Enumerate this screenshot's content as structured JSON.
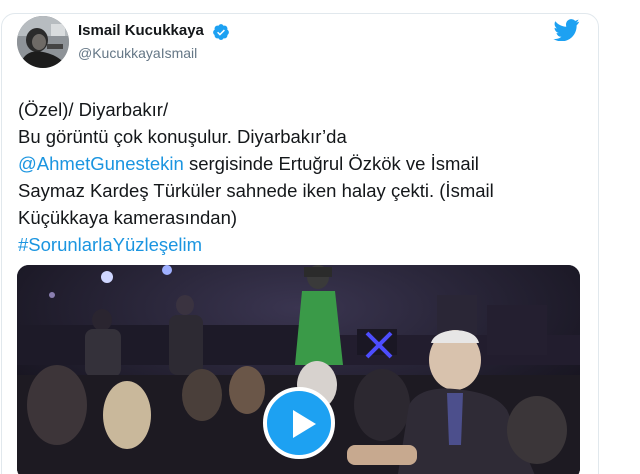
{
  "tweet": {
    "author": {
      "display_name": "Ismail Kucukkaya",
      "handle": "@KucukkayaIsmail",
      "verified": true
    },
    "lines": [
      [
        {
          "text": "(Özel)/ Diyarbakır/"
        }
      ],
      [
        {
          "text": "Bu görüntü çok konuşulur. Diyarbakır’da"
        }
      ],
      [
        {
          "text": "@AhmetGunestekin",
          "link": true
        },
        {
          "text": " sergisinde Ertuğrul Özkök ve İsmail"
        }
      ],
      [
        {
          "text": "Saymaz Kardeş Türküler sahnede iken halay çekti. (İsmail"
        }
      ],
      [
        {
          "text": "Küçükkaya kamerasından)"
        }
      ],
      [
        {
          "text": "#SorunlarlaYüzleşelim",
          "link": true
        }
      ]
    ],
    "media": {
      "type": "video",
      "play_icon": "play-icon"
    },
    "icons": {
      "brand": "twitter-bird-icon",
      "verified": "verified-badge-icon"
    },
    "colors": {
      "link": "#1b95e0",
      "brand": "#1da1f2",
      "text": "#14171a",
      "secondary": "#657786"
    }
  }
}
